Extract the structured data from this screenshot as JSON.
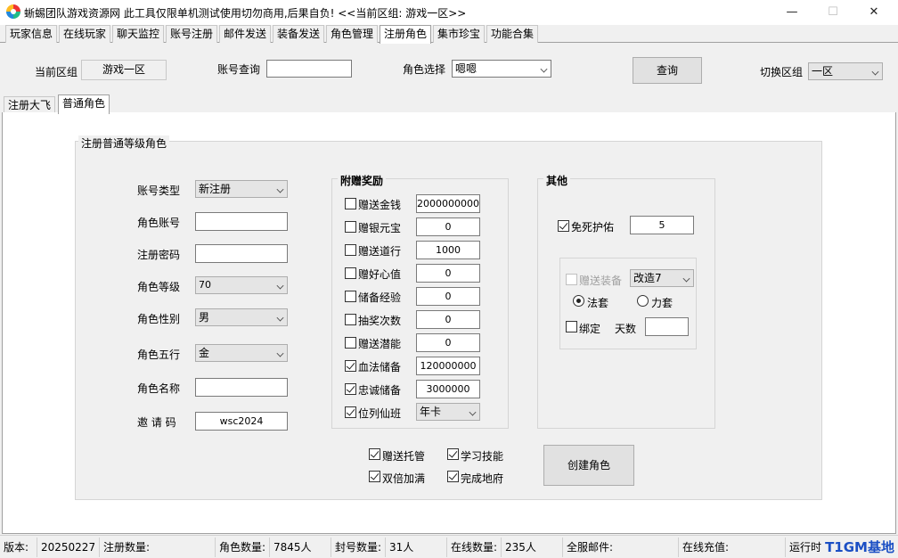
{
  "window": {
    "title": "蜥蜴团队游戏资源网 此工具仅限单机测试使用切勿商用,后果自负! <<当前区组: 游戏一区>>",
    "controls": {
      "minimize": "—",
      "maximize": "☐",
      "close": "✕"
    }
  },
  "menu_tabs": [
    "玩家信息",
    "在线玩家",
    "聊天监控",
    "账号注册",
    "邮件发送",
    "装备发送",
    "角色管理",
    "注册角色",
    "集市珍宝",
    "功能合集"
  ],
  "active_menu_tab": "注册角色",
  "toolbar": {
    "current_zone_label": "当前区组",
    "current_zone_value": "游戏一区",
    "account_query_label": "账号查询",
    "account_query_value": "",
    "role_select_label": "角色选择",
    "role_select_value": "嗯嗯",
    "query_button": "查询",
    "switch_zone_label": "切换区组",
    "switch_zone_value": "一区"
  },
  "sub_tabs": [
    "注册大飞",
    "普通角色"
  ],
  "active_sub_tab": "普通角色",
  "main_group": {
    "title": "注册普通等级角色",
    "fields": {
      "account_type_label": "账号类型",
      "account_type_value": "新注册",
      "role_account_label": "角色账号",
      "role_account_value": "",
      "register_password_label": "注册密码",
      "register_password_value": "",
      "role_level_label": "角色等级",
      "role_level_value": "70",
      "role_gender_label": "角色性别",
      "role_gender_value": "男",
      "role_element_label": "角色五行",
      "role_element_value": "金",
      "role_name_label": "角色名称",
      "role_name_value": "",
      "invite_code_label": "邀 请 码",
      "invite_code_value": "wsc2024"
    }
  },
  "gifts": {
    "title": "附赠奖励",
    "items": [
      {
        "label": "赠送金钱",
        "checked": false,
        "value": "2000000000"
      },
      {
        "label": "赠银元宝",
        "checked": false,
        "value": "0"
      },
      {
        "label": "赠送道行",
        "checked": false,
        "value": "1000"
      },
      {
        "label": "赠好心值",
        "checked": false,
        "value": "0"
      },
      {
        "label": "储备经验",
        "checked": false,
        "value": "0"
      },
      {
        "label": "抽奖次数",
        "checked": false,
        "value": "0"
      },
      {
        "label": "赠送潜能",
        "checked": false,
        "value": "0"
      },
      {
        "label": "血法储备",
        "checked": true,
        "value": "120000000"
      },
      {
        "label": "忠诚储备",
        "checked": true,
        "value": "3000000"
      },
      {
        "label": "位列仙班",
        "checked": true,
        "value": "年卡"
      }
    ]
  },
  "other": {
    "title": "其他",
    "immortal_label": "免死护佑",
    "immortal_checked": true,
    "immortal_value": "5",
    "equip_label": "赠送装备",
    "equip_checked": false,
    "equip_value": "改造7",
    "set_magic_label": "法套",
    "set_magic_checked": true,
    "set_power_label": "力套",
    "set_power_checked": false,
    "bind_label": "绑定",
    "bind_checked": false,
    "days_label": "天数",
    "days_value": ""
  },
  "bottom_options": [
    {
      "label": "赠送托管",
      "checked": true
    },
    {
      "label": "学习技能",
      "checked": true
    },
    {
      "label": "双倍加满",
      "checked": true
    },
    {
      "label": "完成地府",
      "checked": true
    }
  ],
  "create_button": "创建角色",
  "status_bar": [
    {
      "label": "版本:",
      "value": "20250227"
    },
    {
      "label": "注册数量:",
      "value": ""
    },
    {
      "label": "角色数量:",
      "value": "7845人"
    },
    {
      "label": "封号数量:",
      "value": "31人"
    },
    {
      "label": "在线数量:",
      "value": "235人"
    },
    {
      "label": "全服邮件:",
      "value": ""
    },
    {
      "label": "在线充值:",
      "value": ""
    },
    {
      "label": "运行时",
      "value": ""
    }
  ],
  "watermark": "T1GM基地"
}
